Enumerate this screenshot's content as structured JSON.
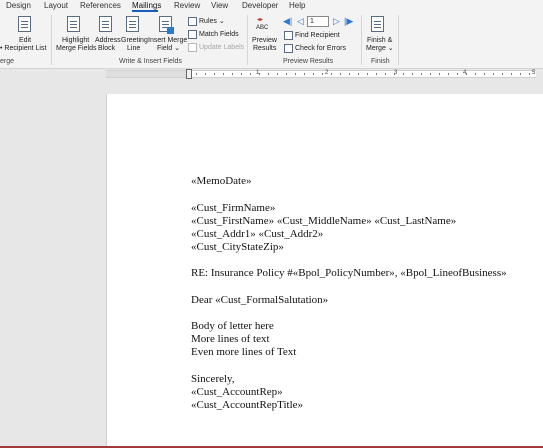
{
  "tabs": [
    {
      "label": "Design",
      "active": false
    },
    {
      "label": "Layout",
      "active": false
    },
    {
      "label": "References",
      "active": false
    },
    {
      "label": "Mailings",
      "active": true
    },
    {
      "label": "Review",
      "active": false
    },
    {
      "label": "View",
      "active": false
    },
    {
      "label": "Developer",
      "active": false
    },
    {
      "label": "Help",
      "active": false
    }
  ],
  "ribbon": {
    "edit_recipient_list": {
      "line1": "Edit",
      "line2": "Recipient List"
    },
    "highlight_merge_fields": {
      "line1": "Highlight",
      "line2": "Merge Fields"
    },
    "address_block": {
      "line1": "Address",
      "line2": "Block"
    },
    "greeting_line": {
      "line1": "Greeting",
      "line2": "Line"
    },
    "insert_merge_field": {
      "line1": "Insert Merge",
      "line2": "Field"
    },
    "rules": "Rules",
    "match_fields": "Match Fields",
    "update_labels": "Update Labels",
    "preview_results": {
      "line1": "Preview",
      "line2": "Results",
      "abc": "ABC"
    },
    "record_number": "1",
    "find_recipient": "Find Recipient",
    "check_for_errors": "Check for Errors",
    "finish_merge": {
      "line1": "Finish &",
      "line2": "Merge"
    },
    "groups": {
      "start": "erge",
      "write_insert": "Write & Insert Fields",
      "preview": "Preview Results",
      "finish": "Finish"
    }
  },
  "ruler": {
    "numbers": [
      "1",
      "2",
      "3",
      "4",
      "5"
    ]
  },
  "document": {
    "lines": [
      "«MemoDate»",
      "«Cust_FirmName»",
      "«Cust_FirstName» «Cust_MiddleName» «Cust_LastName»",
      "«Cust_Addr1» «Cust_Addr2»",
      "«Cust_CityStateZip»",
      "RE:  Insurance Policy  #«Bpol_PolicyNumber», «Bpol_LineofBusiness»",
      "Dear «Cust_FormalSalutation»",
      "Body of letter here",
      "More lines of text",
      "Even more lines of Text",
      "Sincerely,",
      "«Cust_AccountRep»",
      "«Cust_AccountRepTitle»"
    ]
  },
  "colors": {
    "accent": "#185abd",
    "nav_blue": "#2b78d0",
    "status_bar": "#a4373a"
  }
}
